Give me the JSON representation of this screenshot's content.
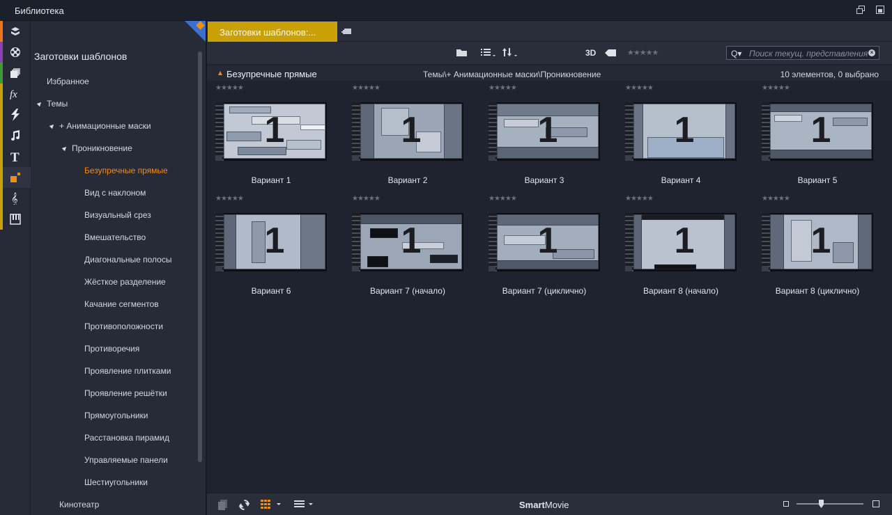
{
  "window": {
    "title": "Библиотека"
  },
  "rail": {
    "items": [
      {
        "name": "projects-icon",
        "color": "#e8781c"
      },
      {
        "name": "video-reel-icon",
        "color": "#8a3fb4"
      },
      {
        "name": "photos-icon",
        "color": "#3e9a3a"
      },
      {
        "name": "effects-fx-icon",
        "color": "#c9a106"
      },
      {
        "name": "transitions-icon",
        "color": "#c9a106"
      },
      {
        "name": "music-note-icon",
        "color": "#c9a106"
      },
      {
        "name": "title-text-icon",
        "color": "#c9a106"
      },
      {
        "name": "templates-icon",
        "color": "#c9a106"
      },
      {
        "name": "treble-clef-icon",
        "color": "#c9a106"
      },
      {
        "name": "piano-icon",
        "color": "#c9a106"
      }
    ]
  },
  "tree": {
    "heading": "Заготовки шаблонов",
    "items": [
      {
        "label": "Избранное",
        "level": 0,
        "expanded": null
      },
      {
        "label": "Темы",
        "level": 0,
        "expanded": true
      },
      {
        "label": "+ Анимационные маски",
        "level": 1,
        "expanded": true
      },
      {
        "label": "Проникновение",
        "level": 2,
        "expanded": true
      },
      {
        "label": "Безупречные прямые",
        "level": 3,
        "selected": true
      },
      {
        "label": "Вид с наклоном",
        "level": 3
      },
      {
        "label": "Визуальный срез",
        "level": 3
      },
      {
        "label": "Вмешательство",
        "level": 3
      },
      {
        "label": "Диагональные полосы",
        "level": 3
      },
      {
        "label": "Жёсткое разделение",
        "level": 3
      },
      {
        "label": "Качание сегментов",
        "level": 3
      },
      {
        "label": "Противоположности",
        "level": 3
      },
      {
        "label": "Противоречия",
        "level": 3
      },
      {
        "label": "Проявление плитками",
        "level": 3
      },
      {
        "label": "Проявление решётки",
        "level": 3
      },
      {
        "label": "Прямоугольники",
        "level": 3
      },
      {
        "label": "Расстановка пирамид",
        "level": 3
      },
      {
        "label": "Управляемые панели",
        "level": 3
      },
      {
        "label": "Шестиугольники",
        "level": 3
      },
      {
        "label": "Кинотеатр",
        "level": 1
      }
    ]
  },
  "tab": {
    "label": "Заготовки шаблонов:..."
  },
  "toolbar": {
    "three_d": "3D",
    "rating": "★★★★★",
    "search_placeholder": "Поиск текущ. представления"
  },
  "section": {
    "title": "Безупречные прямые",
    "path": "Темы\\+ Анимационные маски\\Проникновение",
    "count": "10 элементов, 0 выбрано"
  },
  "thumb_number": "1",
  "items": [
    {
      "label": "Вариант 1",
      "rating": "★★★★★"
    },
    {
      "label": "Вариант 2",
      "rating": "★★★★★"
    },
    {
      "label": "Вариант 3",
      "rating": "★★★★★"
    },
    {
      "label": "Вариант 4",
      "rating": "★★★★★"
    },
    {
      "label": "Вариант 5",
      "rating": "★★★★★"
    },
    {
      "label": "Вариант 6",
      "rating": "★★★★★"
    },
    {
      "label": "Вариант 7 (начало)",
      "rating": "★★★★★"
    },
    {
      "label": "Вариант 7 (циклично)",
      "rating": "★★★★★"
    },
    {
      "label": "Вариант 8 (начало)",
      "rating": "★★★★★"
    },
    {
      "label": "Вариант 8 (циклично)",
      "rating": "★★★★★"
    }
  ],
  "bottombar": {
    "brand_bold": "Smart",
    "brand_rest": "Movie"
  }
}
